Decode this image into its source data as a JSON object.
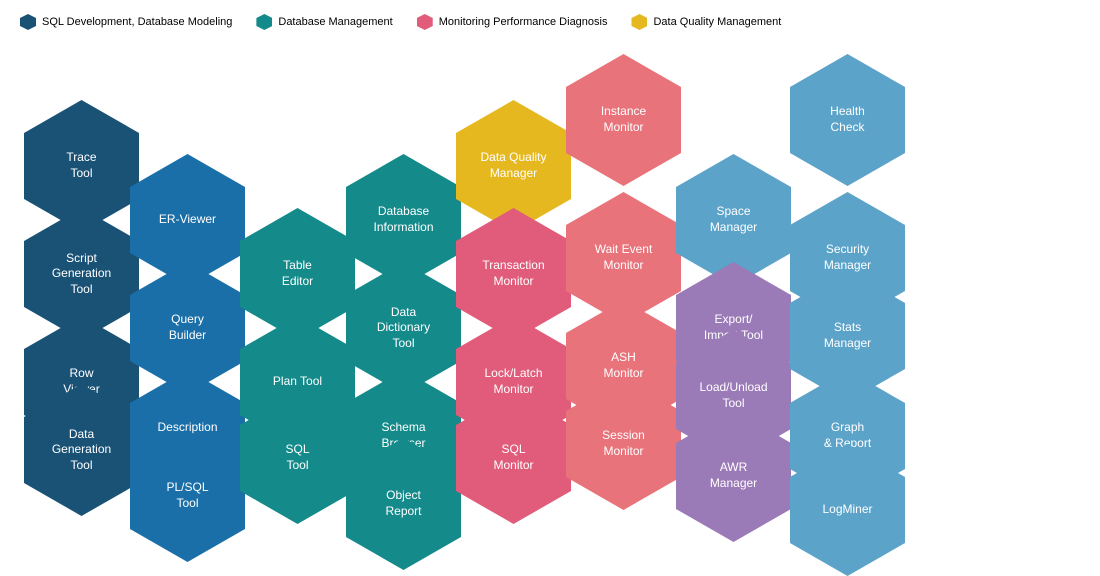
{
  "legend": {
    "items": [
      {
        "label": "SQL Development, Database Modeling",
        "color": "#1a5276",
        "id": "sql-dev"
      },
      {
        "label": "Database Management",
        "color": "#148a8a",
        "id": "db-mgmt"
      },
      {
        "label": "Monitoring Performance Diagnosis",
        "color": "#e05c7a",
        "id": "monitoring"
      },
      {
        "label": "Data Quality Management",
        "color": "#e6b820",
        "id": "data-quality"
      }
    ]
  },
  "hexagons": [
    {
      "id": "trace-tool",
      "label": "Trace\nTool",
      "category": "sql-dev",
      "color": "#1a5276"
    },
    {
      "id": "script-gen",
      "label": "Script\nGeneration\nTool",
      "category": "sql-dev",
      "color": "#1a5276"
    },
    {
      "id": "row-viewer",
      "label": "Row\nViewer",
      "category": "sql-dev",
      "color": "#1a5276"
    },
    {
      "id": "data-gen",
      "label": "Data\nGeneration\nTool",
      "category": "sql-dev",
      "color": "#1a5276"
    },
    {
      "id": "er-viewer",
      "label": "ER-Viewer",
      "category": "sql-dev",
      "color": "#1a6fa8"
    },
    {
      "id": "query-builder",
      "label": "Query\nBuilder",
      "category": "sql-dev",
      "color": "#1a6fa8"
    },
    {
      "id": "description-tool",
      "label": "Description\nTool",
      "category": "sql-dev",
      "color": "#1a6fa8"
    },
    {
      "id": "plsql-tool",
      "label": "PL/SQL\nTool",
      "category": "sql-dev",
      "color": "#1a6fa8"
    },
    {
      "id": "table-editor",
      "label": "Table\nEditor",
      "category": "db-mgmt",
      "color": "#148a8a"
    },
    {
      "id": "plan-tool",
      "label": "Plan Tool",
      "category": "db-mgmt",
      "color": "#148a8a"
    },
    {
      "id": "sql-tool",
      "label": "SQL\nTool",
      "category": "db-mgmt",
      "color": "#148a8a"
    },
    {
      "id": "db-info",
      "label": "Database\nInformation",
      "category": "db-mgmt",
      "color": "#148a8a"
    },
    {
      "id": "data-dict",
      "label": "Data\nDictionary\nTool",
      "category": "db-mgmt",
      "color": "#148a8a"
    },
    {
      "id": "schema-browser",
      "label": "Schema\nBrowser",
      "category": "db-mgmt",
      "color": "#148a8a"
    },
    {
      "id": "object-report",
      "label": "Object\nReport",
      "category": "db-mgmt",
      "color": "#148a8a"
    },
    {
      "id": "data-quality-mgr",
      "label": "Data Quality\nManager",
      "category": "data-quality",
      "color": "#e6b820"
    },
    {
      "id": "transaction-monitor",
      "label": "Transaction\nMonitor",
      "category": "monitoring",
      "color": "#e05c7a"
    },
    {
      "id": "lock-latch",
      "label": "Lock/Latch\nMonitor",
      "category": "monitoring",
      "color": "#e05c7a"
    },
    {
      "id": "sql-monitor",
      "label": "SQL\nMonitor",
      "category": "monitoring",
      "color": "#e05c7a"
    },
    {
      "id": "instance-monitor",
      "label": "Instance\nMonitor",
      "category": "monitoring",
      "color": "#e8737a"
    },
    {
      "id": "wait-event",
      "label": "Wait Event\nMonitor",
      "category": "monitoring",
      "color": "#e8737a"
    },
    {
      "id": "ash-monitor",
      "label": "ASH\nMonitor",
      "category": "monitoring",
      "color": "#e8737a"
    },
    {
      "id": "session-monitor",
      "label": "Session\nMonitor",
      "category": "monitoring",
      "color": "#e8737a"
    },
    {
      "id": "space-manager",
      "label": "Space\nManager",
      "category": "db-mgmt",
      "color": "#5ba3c9"
    },
    {
      "id": "export-import",
      "label": "Export/\nImport Tool",
      "category": "db-mgmt",
      "color": "#9b7ab8"
    },
    {
      "id": "load-unload",
      "label": "Load/Unload\nTool",
      "category": "db-mgmt",
      "color": "#9b7ab8"
    },
    {
      "id": "awr-manager",
      "label": "AWR\nManager",
      "category": "db-mgmt",
      "color": "#9b7ab8"
    },
    {
      "id": "health-check",
      "label": "Health\nCheck",
      "category": "monitoring",
      "color": "#5ba3c9"
    },
    {
      "id": "security-manager",
      "label": "Security\nManager",
      "category": "db-mgmt",
      "color": "#5ba3c9"
    },
    {
      "id": "stats-manager",
      "label": "Stats\nManager",
      "category": "db-mgmt",
      "color": "#5ba3c9"
    },
    {
      "id": "graph-report",
      "label": "Graph\n& Report",
      "category": "db-mgmt",
      "color": "#5ba3c9"
    },
    {
      "id": "logminer",
      "label": "LogMiner",
      "category": "db-mgmt",
      "color": "#5ba3c9"
    }
  ]
}
